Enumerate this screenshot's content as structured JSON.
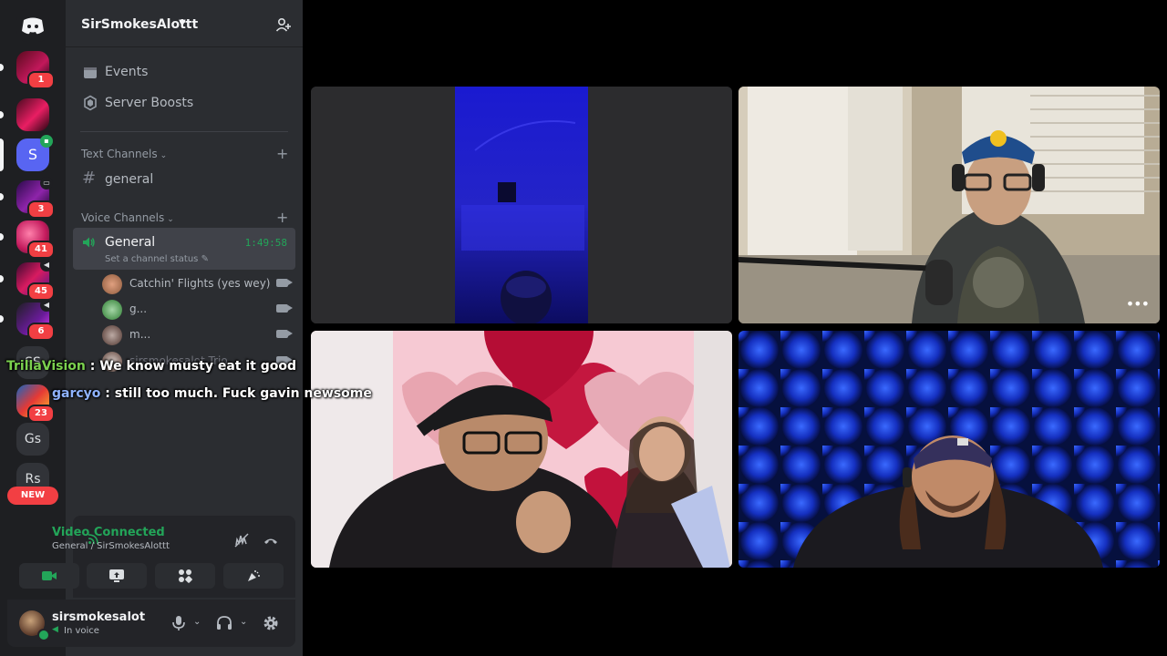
{
  "server": {
    "name": "SirSmokesAlottt",
    "menu": [
      {
        "label": "Events",
        "icon": "calendar-icon"
      },
      {
        "label": "Server Boosts",
        "icon": "boost-icon"
      }
    ],
    "text_category": "Text Channels",
    "text_channels": [
      {
        "label": "general"
      }
    ],
    "voice_category": "Voice Channels",
    "voice_channel": {
      "label": "General",
      "duration": "1:49:58",
      "status_placeholder": "Set a channel status"
    },
    "voice_users": [
      {
        "name": "Catchin' Flights (yes wey)"
      },
      {
        "name": "g..."
      },
      {
        "name": "m..."
      },
      {
        "name": "sirsmokesalot",
        "extra": "Trio"
      }
    ]
  },
  "server_rail": {
    "badges": [
      "1",
      "3",
      "41",
      "45",
      "6",
      "23"
    ],
    "initials": [
      "S",
      "SS",
      "Gs",
      "Rs"
    ],
    "new_label": "NEW"
  },
  "voice_panel": {
    "title": "Video Connected",
    "subtitle": "General / SirSmokesAlottt"
  },
  "user_panel": {
    "username": "sirsmokesalot",
    "status": "In voice"
  },
  "chat_overlay": [
    {
      "user": "TrillaVision",
      "sep": " : ",
      "message": "We know musty eat it good"
    },
    {
      "user": "garcyo",
      "sep": " : ",
      "message": "still too much. Fuck gavin newsome"
    }
  ],
  "colors": {
    "accent_green": "#23a559",
    "brand_blurple": "#5865f2",
    "badge_red": "#f23f43"
  }
}
